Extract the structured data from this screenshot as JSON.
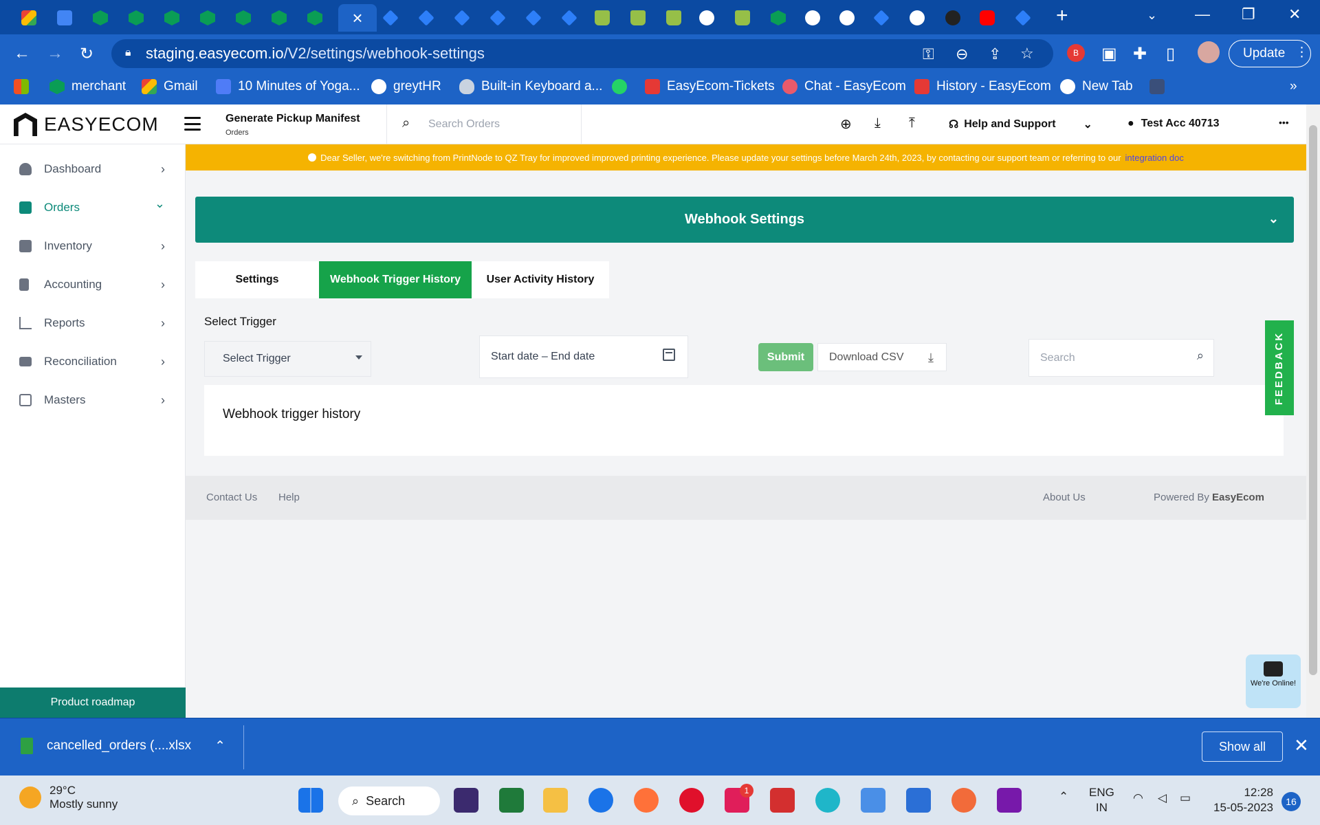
{
  "browser": {
    "url_host": "staging.easyecom.io",
    "url_path": "/V2/settings/webhook-settings",
    "update_label": "Update",
    "bookmarks": [
      "merchant",
      "Gmail",
      "10 Minutes of Yoga...",
      "greytHR",
      "Built-in Keyboard a...",
      "EasyEcom-Tickets",
      "Chat - EasyEcom",
      "History - EasyEcom",
      "New Tab"
    ],
    "bookmarks_overflow": "»"
  },
  "header": {
    "brand": "EASYECOM",
    "crumb_title": "Generate Pickup Manifest",
    "crumb_sub": "Orders",
    "search_placeholder": "Search Orders",
    "help_label": "Help and Support",
    "account_label": "Test Acc 40713",
    "more": "•••"
  },
  "sidebar": {
    "items": [
      {
        "label": "Dashboard",
        "chev": "›"
      },
      {
        "label": "Orders",
        "chev": "⌄"
      },
      {
        "label": "Inventory",
        "chev": "›"
      },
      {
        "label": "Accounting",
        "chev": "›"
      },
      {
        "label": "Reports",
        "chev": "›"
      },
      {
        "label": "Reconciliation",
        "chev": "›"
      },
      {
        "label": "Masters",
        "chev": "›"
      }
    ],
    "roadmap_label": "Product roadmap"
  },
  "banner": {
    "text": "Dear Seller, we're switching from PrintNode to QZ Tray for improved improved printing experience. Please update your settings before March 24th, 2023, by contacting our support team or referring to our",
    "link": "integration doc"
  },
  "main": {
    "section_title": "Webhook Settings",
    "tabs": [
      {
        "label": "Settings"
      },
      {
        "label": "Webhook Trigger History"
      },
      {
        "label": "User Activity History"
      }
    ],
    "select_trigger_label": "Select Trigger",
    "select_trigger_value": "Select Trigger",
    "date_placeholder": "Start date – End date",
    "submit_label": "Submit",
    "download_csv_label": "Download CSV",
    "search_placeholder": "Search",
    "card_title": "Webhook trigger history",
    "feedback_label": "FEEDBACK",
    "chat_text": "We're Online!"
  },
  "footer": {
    "contact": "Contact Us",
    "help": "Help",
    "about": "About Us",
    "powered_by": "Powered By",
    "powered_brand": "EasyEcom"
  },
  "download_bar": {
    "file_name": "cancelled_orders (....xlsx",
    "show_all": "Show all"
  },
  "taskbar": {
    "temperature": "29°C",
    "weather": "Mostly sunny",
    "search_label": "Search",
    "lang_top": "ENG",
    "lang_bottom": "IN",
    "time": "12:28",
    "date": "15-05-2023",
    "notifications": "16",
    "slack_badge": "1"
  },
  "colors": {
    "browser_blue": "#1d63c6",
    "teal": "#0d8a7a",
    "tab_green": "#16a34a",
    "banner_yellow": "#f5b301"
  }
}
